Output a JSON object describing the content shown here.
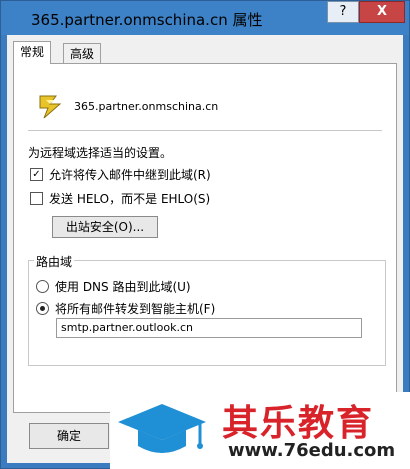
{
  "window": {
    "title": "365.partner.onmschina.cn 属性",
    "help_label": "?",
    "close_label": "X"
  },
  "tabs": [
    {
      "label": "常规"
    },
    {
      "label": "高级"
    }
  ],
  "domain": {
    "name": "365.partner.onmschina.cn",
    "icon": "domain-arrows-icon"
  },
  "settings": {
    "description": "为远程域选择适当的设置。",
    "relay_label": "允许将传入邮件中继到此域(R)",
    "relay_checked": true,
    "helo_label": "发送 HELO，而不是 EHLO(S)",
    "helo_checked": false,
    "outbound_security_label": "出站安全(O)..."
  },
  "routing": {
    "group_label": "路由域",
    "dns_label": "使用 DNS 路由到此域(U)",
    "smarthost_label": "将所有邮件转发到智能主机(F)",
    "selected": "smarthost",
    "smarthost_value": "smtp.partner.outlook.cn"
  },
  "footer": {
    "ok_label": "确定"
  },
  "watermark": {
    "title": "其乐教育",
    "url": "www.76edu.com"
  },
  "colors": {
    "titlebar": "#3d82c6",
    "close": "#c74545",
    "watermark_red": "#d8232a"
  }
}
